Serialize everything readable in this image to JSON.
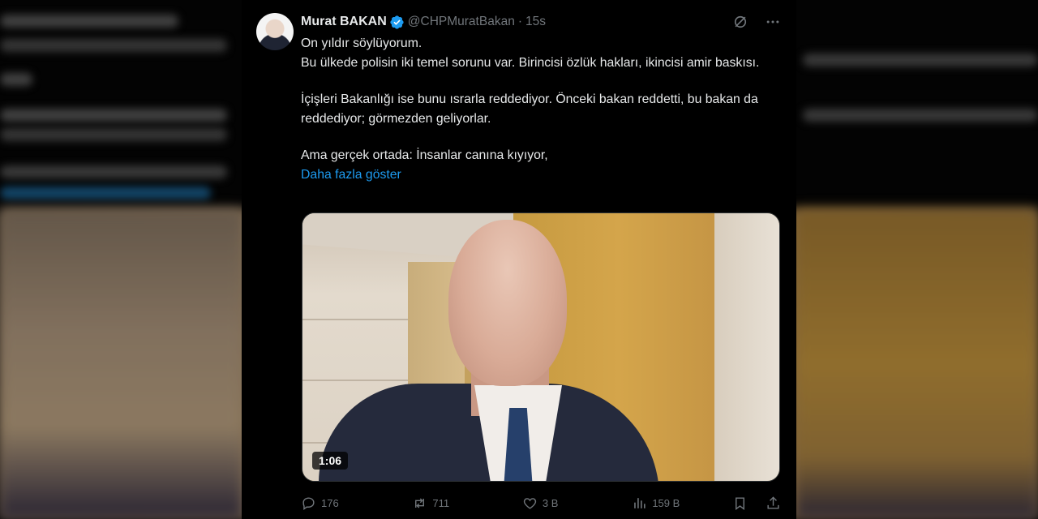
{
  "tweet": {
    "author_name": "Murat BAKAN",
    "handle": "@CHPMuratBakan",
    "separator": "·",
    "time": "15s",
    "lines": [
      "On yıldır söylüyorum.",
      "Bu ülkede polisin iki temel sorunu var. Birincisi özlük hakları, ikincisi amir baskısı.",
      "İçişleri Bakanlığı ise bunu ısrarla reddediyor. Önceki bakan reddetti, bu bakan da reddediyor; görmezden geliyorlar.",
      "Ama gerçek ortada: İnsanlar canına kıyıyor,"
    ],
    "show_more": "Daha fazla göster",
    "video_duration": "1:06"
  },
  "actions": {
    "replies": "176",
    "reposts": "711",
    "likes": "3 B",
    "views": "159 B"
  },
  "colors": {
    "background": "#000000",
    "text": "#e7e9ea",
    "muted": "#71767b",
    "link": "#1d9bf0",
    "verified": "#1d9bf0"
  },
  "icons": [
    "verified-badge-icon",
    "grok-icon",
    "more-icon",
    "reply-icon",
    "repost-icon",
    "like-icon",
    "views-icon",
    "bookmark-icon",
    "share-icon"
  ]
}
